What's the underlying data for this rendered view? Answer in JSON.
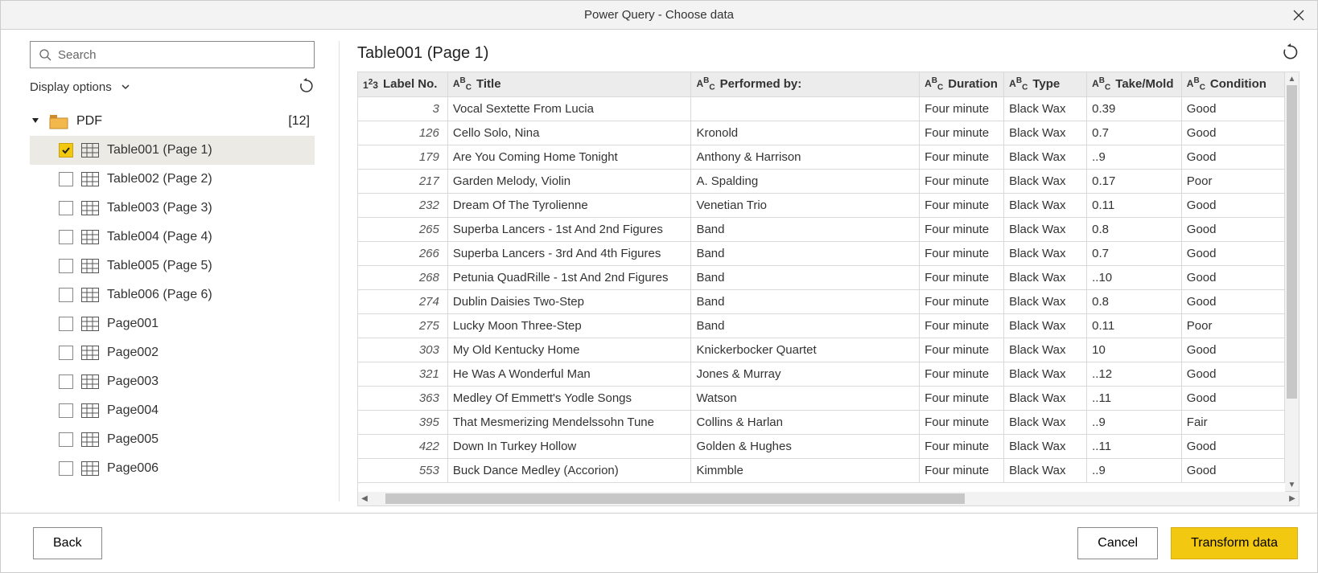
{
  "window": {
    "title": "Power Query - Choose data"
  },
  "left": {
    "search_placeholder": "Search",
    "display_options_label": "Display options",
    "root": {
      "label": "PDF",
      "count": "[12]"
    },
    "items": [
      {
        "label": "Table001 (Page 1)",
        "kind": "table",
        "checked": true,
        "selected": true
      },
      {
        "label": "Table002 (Page 2)",
        "kind": "table",
        "checked": false,
        "selected": false
      },
      {
        "label": "Table003 (Page 3)",
        "kind": "table",
        "checked": false,
        "selected": false
      },
      {
        "label": "Table004 (Page 4)",
        "kind": "table",
        "checked": false,
        "selected": false
      },
      {
        "label": "Table005 (Page 5)",
        "kind": "table",
        "checked": false,
        "selected": false
      },
      {
        "label": "Table006 (Page 6)",
        "kind": "table",
        "checked": false,
        "selected": false
      },
      {
        "label": "Page001",
        "kind": "page",
        "checked": false,
        "selected": false
      },
      {
        "label": "Page002",
        "kind": "page",
        "checked": false,
        "selected": false
      },
      {
        "label": "Page003",
        "kind": "page",
        "checked": false,
        "selected": false
      },
      {
        "label": "Page004",
        "kind": "page",
        "checked": false,
        "selected": false
      },
      {
        "label": "Page005",
        "kind": "page",
        "checked": false,
        "selected": false
      },
      {
        "label": "Page006",
        "kind": "page",
        "checked": false,
        "selected": false
      }
    ]
  },
  "preview": {
    "title": "Table001 (Page 1)",
    "columns": [
      {
        "label": "Label No.",
        "type": "number"
      },
      {
        "label": "Title",
        "type": "text"
      },
      {
        "label": "Performed by:",
        "type": "text"
      },
      {
        "label": "Duration",
        "type": "text"
      },
      {
        "label": "Type",
        "type": "text"
      },
      {
        "label": "Take/Mold",
        "type": "text"
      },
      {
        "label": "Condition",
        "type": "text"
      }
    ],
    "rows": [
      [
        "3",
        "Vocal Sextette From Lucia",
        "",
        "Four minute",
        "Black Wax",
        "0.39",
        "Good"
      ],
      [
        "126",
        "Cello Solo, Nina",
        "Kronold",
        "Four minute",
        "Black Wax",
        "0.7",
        "Good"
      ],
      [
        "179",
        "Are You Coming Home Tonight",
        "Anthony & Harrison",
        "Four minute",
        "Black Wax",
        "..9",
        "Good"
      ],
      [
        "217",
        "Garden Melody, Violin",
        "A. Spalding",
        "Four minute",
        "Black Wax",
        "0.17",
        "Poor"
      ],
      [
        "232",
        "Dream Of The Tyrolienne",
        "Venetian Trio",
        "Four minute",
        "Black Wax",
        "0.11",
        "Good"
      ],
      [
        "265",
        "Superba Lancers - 1st And 2nd Figures",
        "Band",
        "Four minute",
        "Black Wax",
        "0.8",
        "Good"
      ],
      [
        "266",
        "Superba Lancers - 3rd And 4th Figures",
        "Band",
        "Four minute",
        "Black Wax",
        "0.7",
        "Good"
      ],
      [
        "268",
        "Petunia QuadRille - 1st And 2nd Figures",
        "Band",
        "Four minute",
        "Black Wax",
        "..10",
        "Good"
      ],
      [
        "274",
        "Dublin Daisies Two-Step",
        "Band",
        "Four minute",
        "Black Wax",
        "0.8",
        "Good"
      ],
      [
        "275",
        "Lucky Moon Three-Step",
        "Band",
        "Four minute",
        "Black Wax",
        "0.11",
        "Poor"
      ],
      [
        "303",
        "My Old Kentucky Home",
        "Knickerbocker Quartet",
        "Four minute",
        "Black Wax",
        "10",
        "Good"
      ],
      [
        "321",
        "He Was A Wonderful Man",
        "Jones & Murray",
        "Four minute",
        "Black Wax",
        "..12",
        "Good"
      ],
      [
        "363",
        "Medley Of Emmett's Yodle Songs",
        "Watson",
        "Four minute",
        "Black Wax",
        "..11",
        "Good"
      ],
      [
        "395",
        "That Mesmerizing Mendelssohn Tune",
        "Collins & Harlan",
        "Four minute",
        "Black Wax",
        "..9",
        "Fair"
      ],
      [
        "422",
        "Down In Turkey Hollow",
        "Golden & Hughes",
        "Four minute",
        "Black Wax",
        "..11",
        "Good"
      ],
      [
        "553",
        "Buck Dance Medley (Accorion)",
        "Kimmble",
        "Four minute",
        "Black Wax",
        "..9",
        "Good"
      ]
    ]
  },
  "footer": {
    "back": "Back",
    "cancel": "Cancel",
    "transform": "Transform data"
  }
}
